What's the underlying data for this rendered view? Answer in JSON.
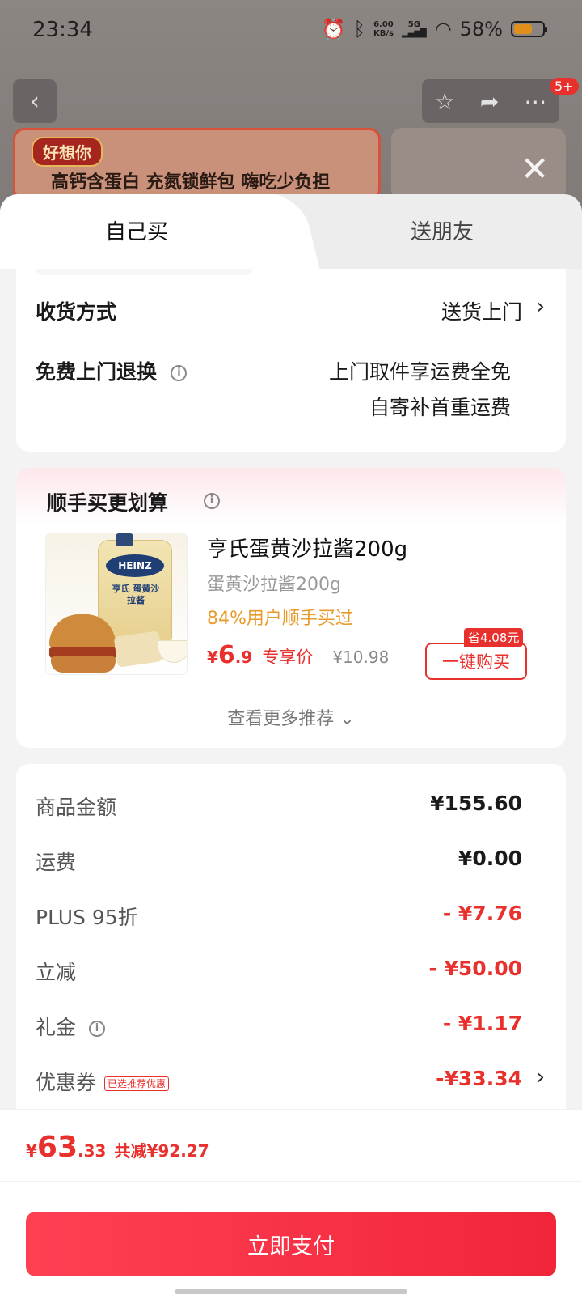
{
  "status_bar": {
    "time": "23:34",
    "net_speed_value": "6.00",
    "net_speed_unit": "KB/s",
    "signal_label": "5G",
    "battery_pct": "58%"
  },
  "background": {
    "badge": "5+",
    "banner_logo": "好想你",
    "banner_text": "高钙含蛋白 充氮锁鲜包 嗨吃少负担"
  },
  "tabs": [
    {
      "label": "自己买",
      "active": true
    },
    {
      "label": "送朋友",
      "active": false
    }
  ],
  "delivery": {
    "method_label": "收货方式",
    "method_value": "送货上门",
    "return_label": "免费上门退换",
    "return_value_line1": "上门取件享运费全免",
    "return_value_line2": "自寄补首重运费"
  },
  "addon": {
    "title": "顺手买更划算",
    "product": {
      "name": "亨氏蛋黄沙拉酱200g",
      "spec": "蛋黄沙拉酱200g",
      "social_proof": "84%用户顺手买过",
      "price_currency": "¥",
      "price_int": "6",
      "price_dec": ".9",
      "price_tag": "专享价",
      "original_price": "¥10.98",
      "save_badge": "省4.08元",
      "buy_button": "一键购买",
      "image_brand": "HEINZ",
      "image_text": "亨氏 蛋黄沙拉酱"
    },
    "more_label": "查看更多推荐"
  },
  "fees": [
    {
      "label": "商品金额",
      "value": "¥155.60",
      "red": false
    },
    {
      "label": "运费",
      "value": "¥0.00",
      "red": false
    },
    {
      "label": "PLUS 95折",
      "value": "- ¥7.76",
      "red": true
    },
    {
      "label": "立减",
      "value": "- ¥50.00",
      "red": true
    },
    {
      "label": "礼金",
      "value": "- ¥1.17",
      "red": true
    },
    {
      "label": "优惠券",
      "value": "-¥33.34",
      "red": true,
      "tag": "已选推荐优惠"
    }
  ],
  "footer": {
    "total_currency": "¥",
    "total_int": "63",
    "total_dec": ".33",
    "total_saved": "共减¥92.27",
    "pay_button": "立即支付"
  },
  "colors": {
    "accent": "#e8302d",
    "pay_button": "#f2253a",
    "social_proof": "#e89a2a"
  }
}
